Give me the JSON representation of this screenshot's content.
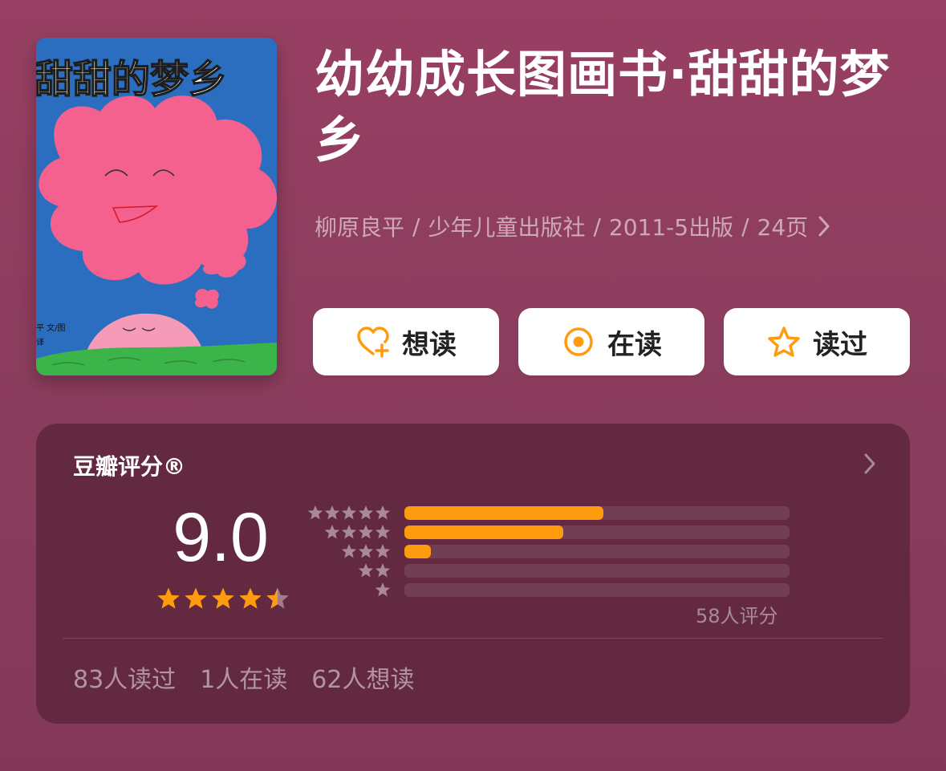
{
  "book": {
    "title": "幼幼成长图画书·甜甜的梦乡",
    "meta": [
      "柳原良平",
      "少年儿童出版社",
      "2011-5出版",
      "24页"
    ],
    "cover": {
      "title_text": "甜甜的梦乡",
      "author_text": "平 文/图",
      "translator_text": "译"
    }
  },
  "actions": [
    {
      "label": "想读",
      "icon": "heart-plus-icon"
    },
    {
      "label": "在读",
      "icon": "dot-circle-icon"
    },
    {
      "label": "读过",
      "icon": "star-outline-icon"
    }
  ],
  "rating": {
    "title": "豆瓣评分®",
    "score": "9.0",
    "score_stars": 4.5,
    "votes": "58人评分",
    "distribution": [
      {
        "stars": 5,
        "fraction": 0.517
      },
      {
        "stars": 4,
        "fraction": 0.413
      },
      {
        "stars": 3,
        "fraction": 0.069
      },
      {
        "stars": 2,
        "fraction": 0
      },
      {
        "stars": 1,
        "fraction": 0
      }
    ]
  },
  "stats": {
    "read": "83人读过",
    "reading": "1人在读",
    "want": "62人想读"
  },
  "colors": {
    "background": "#983f63",
    "card": "#632940",
    "accent": "#ff9b0e",
    "button": "#ffffff"
  }
}
